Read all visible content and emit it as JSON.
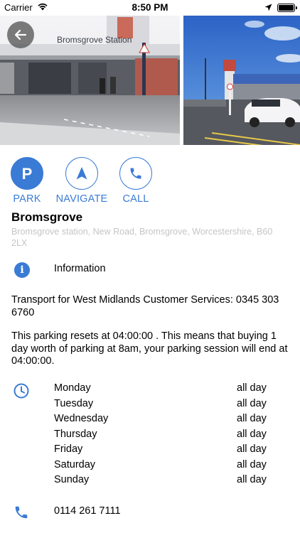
{
  "status_bar": {
    "carrier": "Carrier",
    "time": "8:50 PM"
  },
  "photos": {
    "station_sign": "Bromsgrove Station"
  },
  "actions": [
    {
      "label": "PARK",
      "icon": "parking-icon",
      "filled": true
    },
    {
      "label": "NAVIGATE",
      "icon": "navigate-arrow-icon",
      "filled": false
    },
    {
      "label": "CALL",
      "icon": "phone-icon",
      "filled": false
    }
  ],
  "location": {
    "name": "Bromsgrove",
    "address": "Bromsgrove station, New Road, Bromsgrove, Worcestershire, B60 2LX"
  },
  "info": {
    "label": "Information",
    "icon": "info-icon"
  },
  "paragraphs": {
    "contact": "Transport for West Midlands Customer Services: 0345 303 6760",
    "reset": "This parking resets at 04:00:00 . This means that buying 1 day worth of parking at 8am, your parking session will end at 04:00:00."
  },
  "hours": [
    {
      "day": "Monday",
      "value": "all day"
    },
    {
      "day": "Tuesday",
      "value": "all day"
    },
    {
      "day": "Wednesday",
      "value": "all day"
    },
    {
      "day": "Thursday",
      "value": "all day"
    },
    {
      "day": "Friday",
      "value": "all day"
    },
    {
      "day": "Saturday",
      "value": "all day"
    },
    {
      "day": "Sunday",
      "value": "all day"
    }
  ],
  "phone": {
    "number": "0114 261 7111"
  },
  "colors": {
    "accent": "#3a7bd5",
    "address_gray": "#c5c5c5"
  }
}
